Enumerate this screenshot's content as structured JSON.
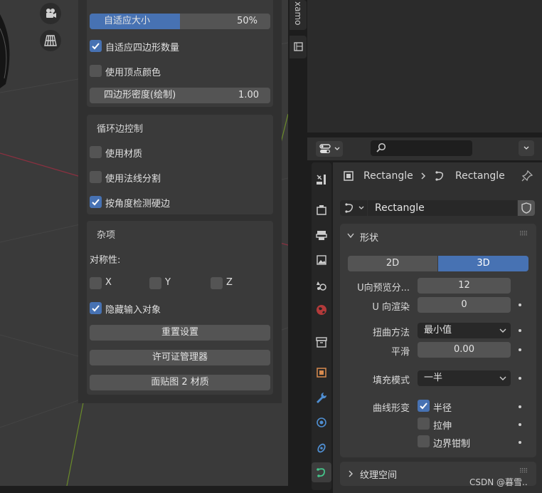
{
  "left_panel": {
    "auto_size": {
      "label": "自适应大小",
      "value": "50%",
      "fill": 0.5
    },
    "auto_quad_count": {
      "label": "自适应四边形数量",
      "checked": true
    },
    "use_vertex_color": {
      "label": "使用顶点颜色",
      "checked": false
    },
    "quad_density": {
      "label": "四边形密度(绘制)",
      "value": "1.00"
    },
    "loop_section": {
      "title": "循环边控制",
      "use_material": {
        "label": "使用材质",
        "checked": false
      },
      "use_normal_split": {
        "label": "使用法线分割",
        "checked": false
      },
      "detect_hard_edges": {
        "label": "按角度检测硬边",
        "checked": true
      }
    },
    "misc_section": {
      "title": "杂项",
      "symmetry_label": "对称性:",
      "sym_x": "X",
      "sym_y": "Y",
      "sym_z": "Z",
      "hide_input": {
        "label": "隐藏输入对象",
        "checked": true
      },
      "reset_button": "重置设置",
      "license_button": "许可证管理器",
      "material_button": "面贴图 2 材质"
    }
  },
  "side_tab_text": "xamo",
  "properties": {
    "breadcrumb": {
      "object": "Rectangle",
      "data": "Rectangle"
    },
    "data_name": "Rectangle",
    "shape_panel": {
      "title": "形状",
      "tab_2d": "2D",
      "tab_3d": "3D",
      "active_tab": "3D",
      "u_preview_label": "U向预览分...",
      "u_preview_value": "12",
      "u_render_label": "U 向渲染",
      "u_render_value": "0",
      "twist_label": "扭曲方法",
      "twist_value": "最小值",
      "smooth_label": "平滑",
      "smooth_value": "0.00",
      "fill_label": "填充模式",
      "fill_value": "一半",
      "deform_label": "曲线形变",
      "radius_label": "半径",
      "radius_checked": true,
      "stretch_label": "拉伸",
      "stretch_checked": false,
      "bounds_label": "边界钳制",
      "bounds_checked": false
    },
    "texture_panel": {
      "title": "纹理空间"
    }
  },
  "watermark": "CSDN @暮雪.."
}
